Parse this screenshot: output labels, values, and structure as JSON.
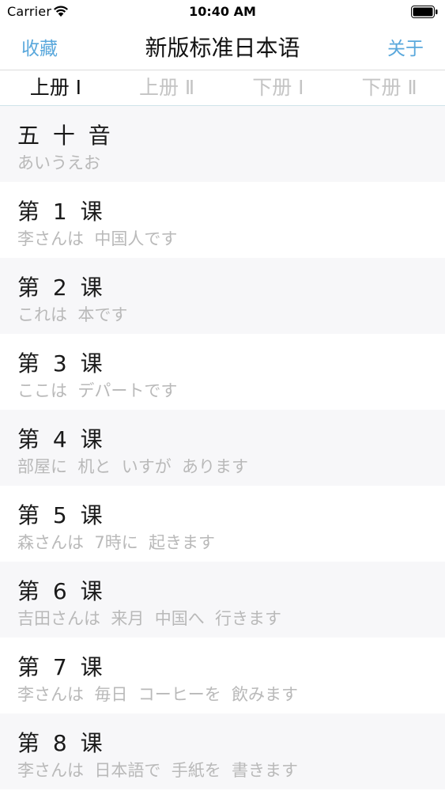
{
  "status_bar": {
    "carrier": "Carrier",
    "time": "10:40 AM",
    "wifi_icon": "wifi-icon",
    "battery_icon": "battery-icon"
  },
  "nav": {
    "left_label": "收藏",
    "title": "新版标准日本语",
    "right_label": "关于",
    "accent_color": "#5aa8dc"
  },
  "tabs": [
    {
      "label": "上册 Ⅰ",
      "active": true
    },
    {
      "label": "上册 Ⅱ",
      "active": false
    },
    {
      "label": "下册 Ⅰ",
      "active": false
    },
    {
      "label": "下册 Ⅱ",
      "active": false
    }
  ],
  "lessons": [
    {
      "title": "五 十 音",
      "subtitle": "あいうえお"
    },
    {
      "title": "第 1 课",
      "subtitle": "李さんは  中国人です"
    },
    {
      "title": "第 2 课",
      "subtitle": "これは  本です"
    },
    {
      "title": "第 3 课",
      "subtitle": "ここは  デパートです"
    },
    {
      "title": "第 4 课",
      "subtitle": "部屋に  机と  いすが  あります"
    },
    {
      "title": "第 5 课",
      "subtitle": "森さんは  7時に  起きます"
    },
    {
      "title": "第 6 课",
      "subtitle": "吉田さんは  来月  中国へ  行きます"
    },
    {
      "title": "第 7 课",
      "subtitle": "李さんは  毎日  コーヒーを  飲みます"
    },
    {
      "title": "第 8 课",
      "subtitle": "李さんは  日本語で  手紙を  書きます"
    }
  ]
}
